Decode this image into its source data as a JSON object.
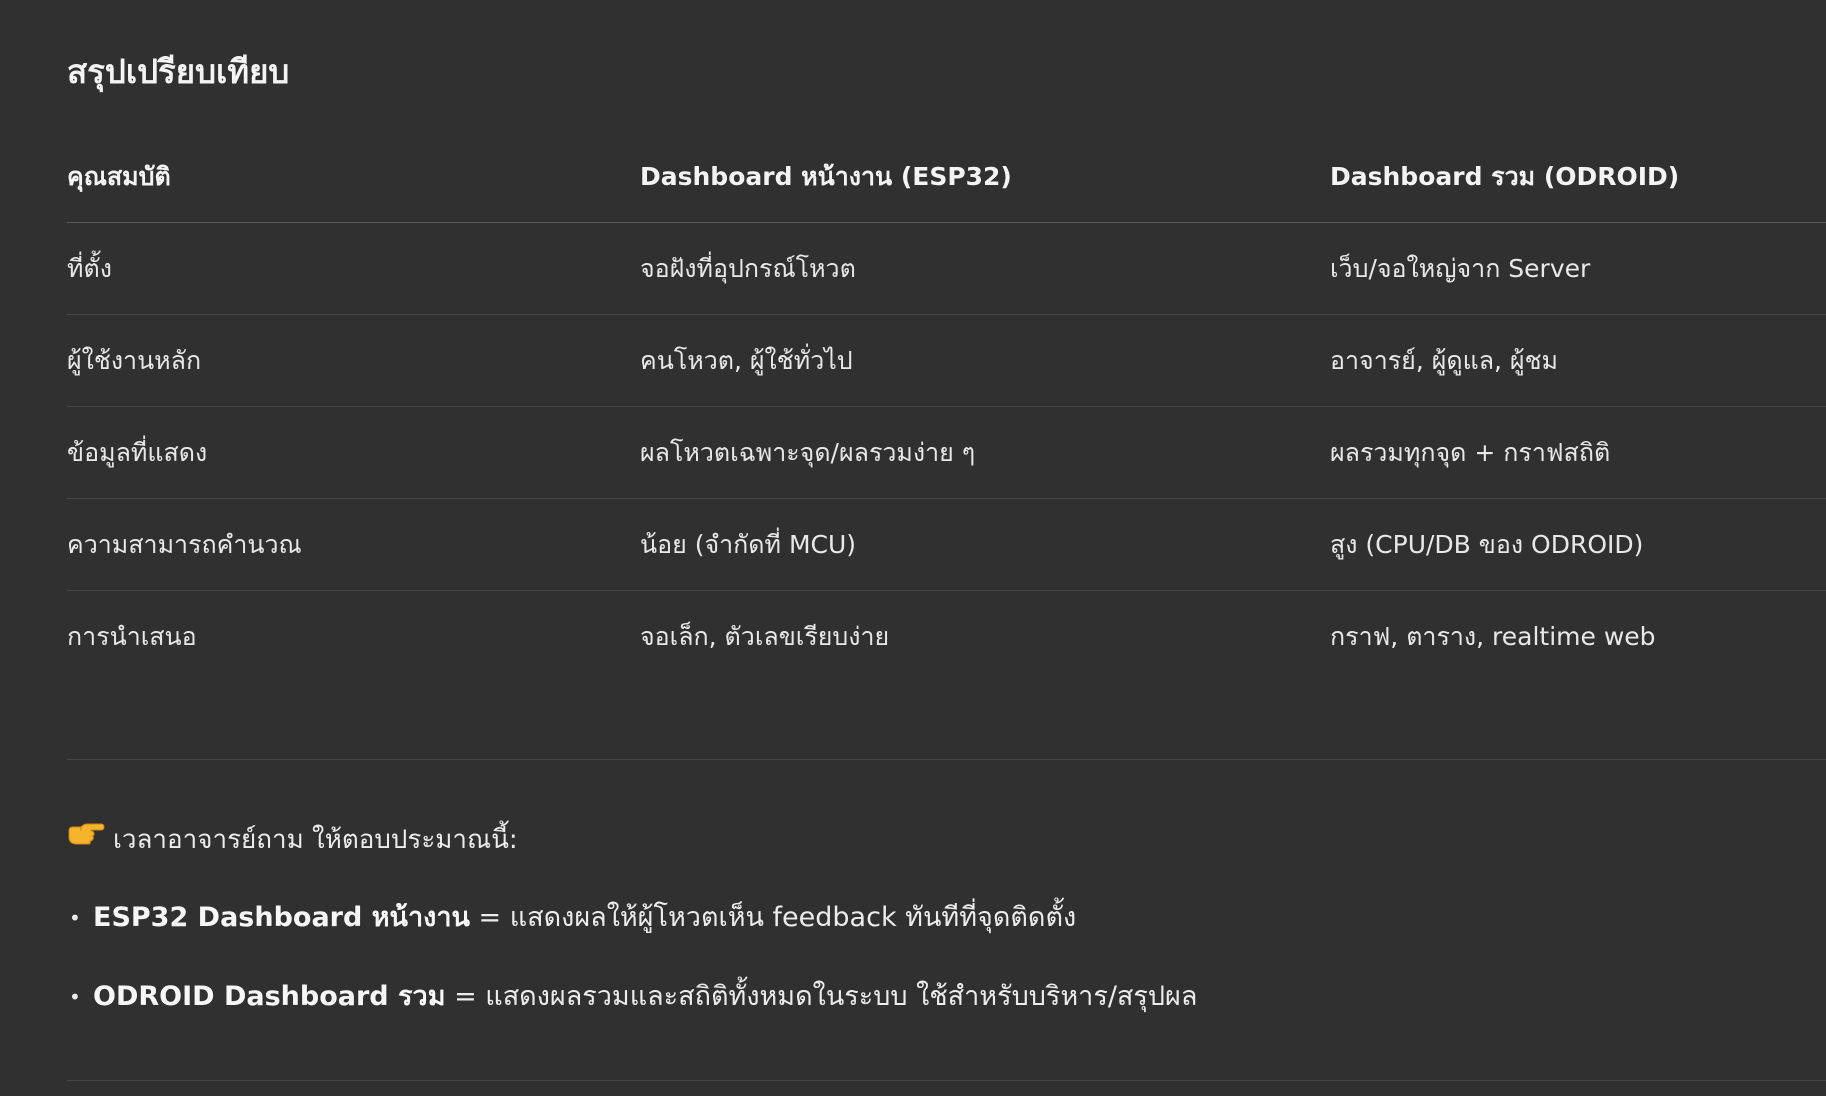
{
  "heading": "สรุปเปรียบเทียบ",
  "table": {
    "headers": [
      "คุณสมบัติ",
      "Dashboard หน้างาน (ESP32)",
      "Dashboard รวม (ODROID)"
    ],
    "rows": [
      [
        "ที่ตั้ง",
        "จอฝังที่อุปกรณ์โหวต",
        "เว็บ/จอใหญ่จาก Server"
      ],
      [
        "ผู้ใช้งานหลัก",
        "คนโหวต, ผู้ใช้ทั่วไป",
        "อาจารย์, ผู้ดูแล, ผู้ชม"
      ],
      [
        "ข้อมูลที่แสดง",
        "ผลโหวตเฉพาะจุด/ผลรวมง่าย ๆ",
        "ผลรวมทุกจุด + กราฟสถิติ"
      ],
      [
        "ความสามารถคำนวณ",
        "น้อย (จำกัดที่ MCU)",
        "สูง (CPU/DB ของ ODROID)"
      ],
      [
        "การนำเสนอ",
        "จอเล็ก, ตัวเลขเรียบง่าย",
        "กราฟ, ตาราง, realtime web"
      ]
    ]
  },
  "note": {
    "icon": "pointing-hand-icon",
    "text": "เวลาอาจารย์ถาม ให้ตอบประมาณนี้:"
  },
  "bullets": [
    {
      "bold": "ESP32 Dashboard หน้างาน",
      "rest": " = แสดงผลให้ผู้โหวตเห็น feedback ทันทีที่จุดติดตั้ง"
    },
    {
      "bold": "ODROID Dashboard รวม",
      "rest": " = แสดงผลรวมและสถิติทั้งหมดในระบบ ใช้สำหรับบริหาร/สรุปผล"
    }
  ]
}
